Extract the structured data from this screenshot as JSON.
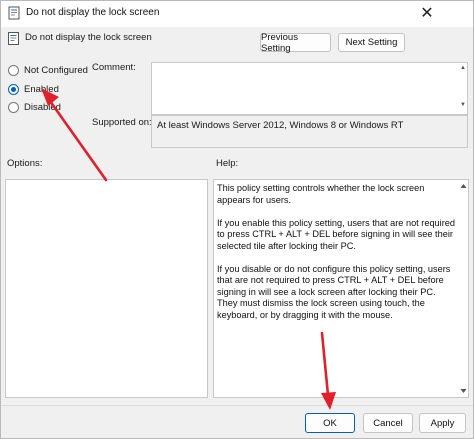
{
  "window": {
    "title": "Do not display the lock screen",
    "close_glyph": "✕"
  },
  "header": {
    "title": "Do not display the lock screen",
    "previous_label": "Previous Setting",
    "next_label": "Next Setting"
  },
  "state": {
    "options": [
      {
        "label": "Not Configured",
        "checked": false
      },
      {
        "label": "Enabled",
        "checked": true
      },
      {
        "label": "Disabled",
        "checked": false
      }
    ]
  },
  "comment": {
    "label": "Comment:",
    "value": ""
  },
  "supported": {
    "label": "Supported on:",
    "value": "At least Windows Server 2012, Windows 8 or Windows RT"
  },
  "options_label": "Options:",
  "help": {
    "label": "Help:",
    "paragraphs": [
      "This policy setting controls whether the lock screen appears for users.",
      "If you enable this policy setting, users that are not required to press CTRL + ALT + DEL before signing in will see their selected tile after locking their PC.",
      "If you disable or do not configure this policy setting, users that are not required to press CTRL + ALT + DEL before signing in will see a lock screen after locking their PC. They must dismiss the lock screen using touch, the keyboard, or by dragging it with the mouse."
    ]
  },
  "footer": {
    "ok_label": "OK",
    "cancel_label": "Cancel",
    "apply_label": "Apply"
  },
  "colors": {
    "accent": "#005fb8",
    "annotation_arrow": "#e0202a"
  },
  "icons": {
    "title": "policy-document-icon",
    "header": "policy-document-icon",
    "close": "close-icon"
  }
}
